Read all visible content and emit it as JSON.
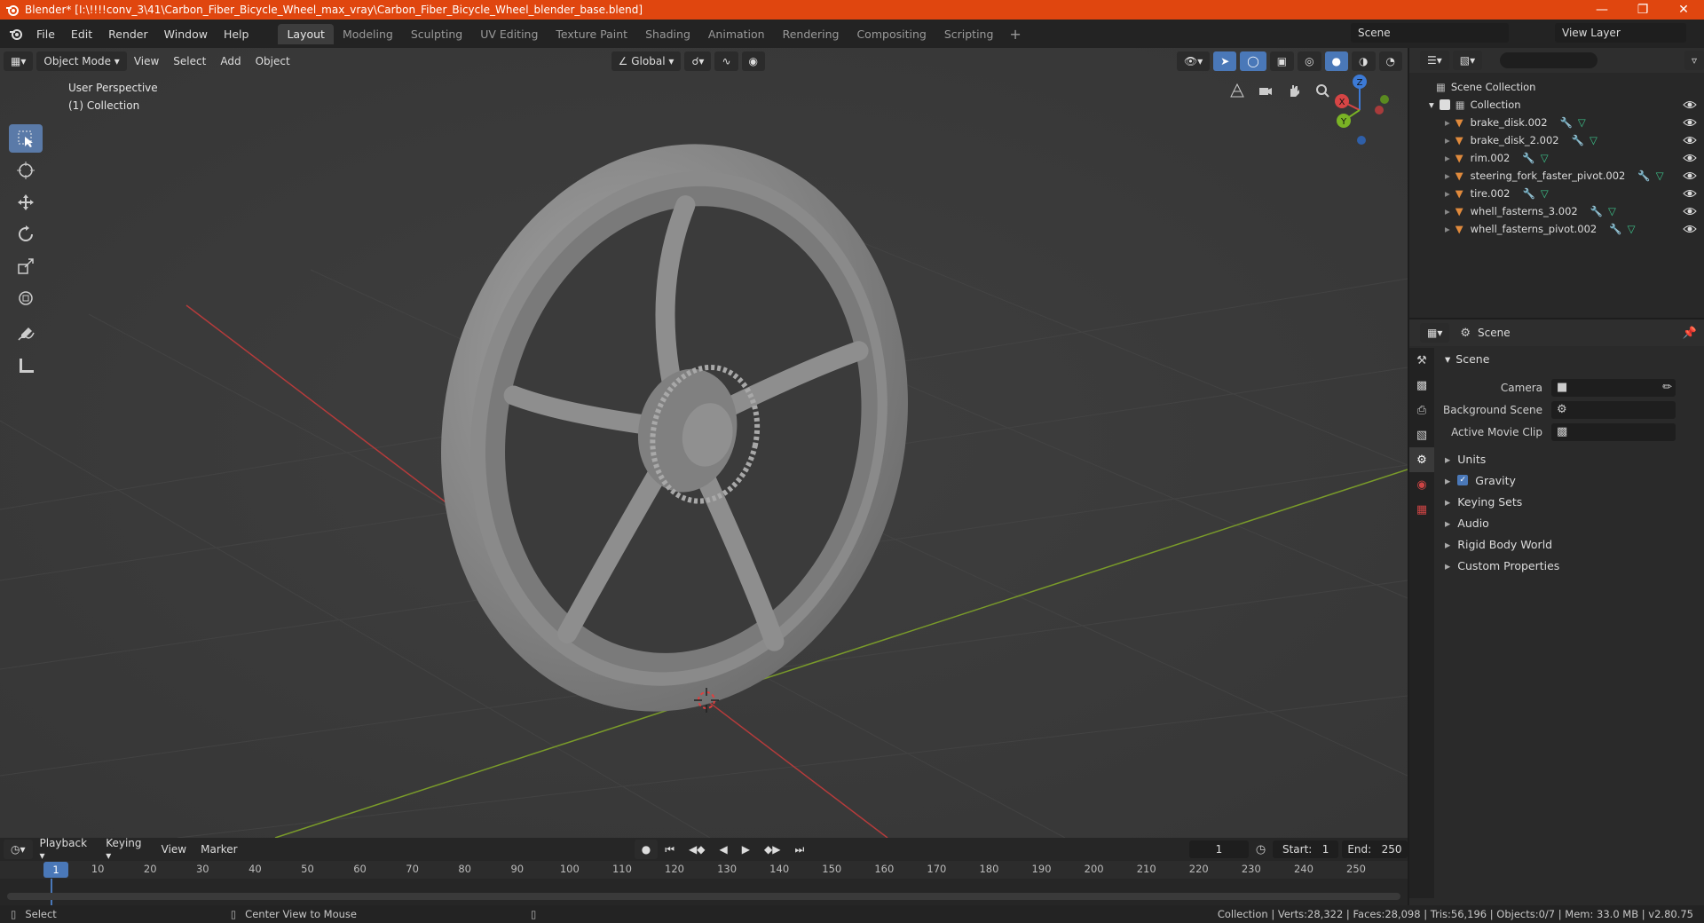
{
  "titlebar": {
    "title": "Blender* [I:\\!!!!conv_3\\41\\Carbon_Fiber_Bicycle_Wheel_max_vray\\Carbon_Fiber_Bicycle_Wheel_blender_base.blend]"
  },
  "menu": [
    "File",
    "Edit",
    "Render",
    "Window",
    "Help"
  ],
  "workspaces": [
    "Layout",
    "Modeling",
    "Sculpting",
    "UV Editing",
    "Texture Paint",
    "Shading",
    "Animation",
    "Rendering",
    "Compositing",
    "Scripting"
  ],
  "active_workspace": "Layout",
  "scene_name": "Scene",
  "view_layer": "View Layer",
  "viewport": {
    "mode": "Object Mode",
    "menus": [
      "View",
      "Select",
      "Add",
      "Object"
    ],
    "transform_orientation": "Global",
    "perspective_label": "User Perspective",
    "collection_label": "(1) Collection"
  },
  "outliner": {
    "root": "Scene Collection",
    "collection": "Collection",
    "objects": [
      "brake_disk.002",
      "brake_disk_2.002",
      "rim.002",
      "steering_fork_faster_pivot.002",
      "tire.002",
      "whell_fasterns_3.002",
      "whell_fasterns_pivot.002"
    ]
  },
  "properties": {
    "header": "Scene",
    "section": "Scene",
    "fields": [
      {
        "label": "Camera"
      },
      {
        "label": "Background Scene"
      },
      {
        "label": "Active Movie Clip"
      }
    ],
    "subsections": [
      "Units",
      "Gravity",
      "Keying Sets",
      "Audio",
      "Rigid Body World",
      "Custom Properties"
    ]
  },
  "timeline": {
    "menus": [
      "Playback",
      "Keying",
      "View",
      "Marker"
    ],
    "current_frame": "1",
    "start_label": "Start:",
    "start": "1",
    "end_label": "End:",
    "end": "250",
    "ticks": [
      "1",
      "10",
      "20",
      "30",
      "40",
      "50",
      "60",
      "70",
      "80",
      "90",
      "100",
      "110",
      "120",
      "130",
      "140",
      "150",
      "160",
      "170",
      "180",
      "190",
      "200",
      "210",
      "220",
      "230",
      "240",
      "250"
    ]
  },
  "status": {
    "left": "Select",
    "middle": "Center View to Mouse",
    "right": "Collection | Verts:28,322 | Faces:28,098 | Tris:56,196 | Objects:0/7 | Mem: 33.0 MB | v2.80.75"
  },
  "colors": {
    "titlebar": "#e0460f",
    "viewport_bg": "#3a3a3a",
    "accent": "#4a78b8",
    "x_axis": "#b53b3b",
    "y_axis": "#7a9b2a"
  }
}
